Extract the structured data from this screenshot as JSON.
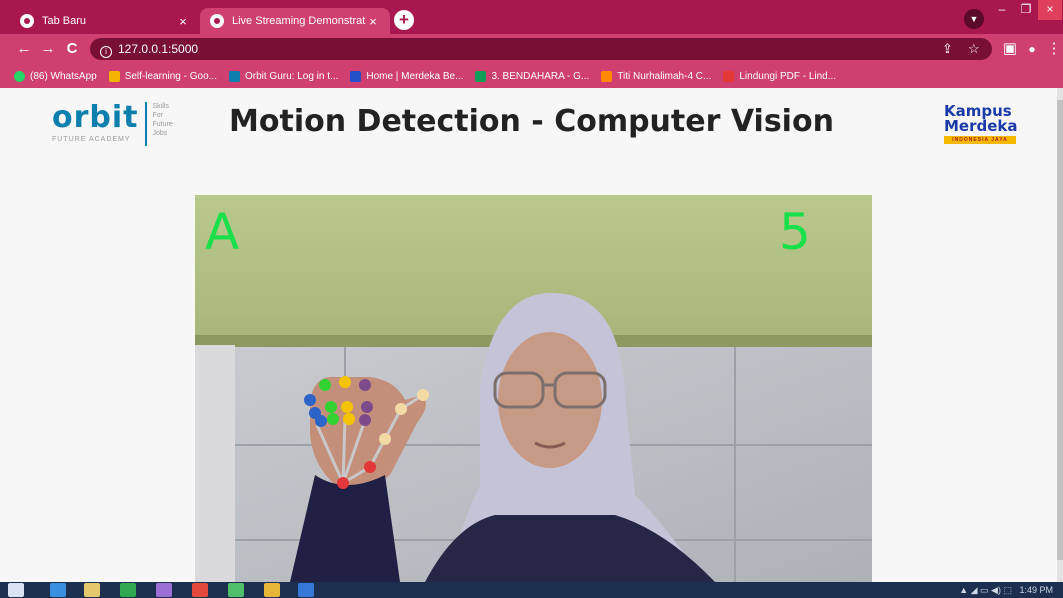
{
  "browser": {
    "tabs": [
      {
        "title": "Tab Baru",
        "active": false
      },
      {
        "title": "Live Streaming Demonstration",
        "active": true
      }
    ],
    "tab_close_glyph": "×",
    "new_tab_glyph": "+",
    "window_buttons": [
      "–",
      "❐",
      "×"
    ],
    "url": "127.0.0.1:5000",
    "bookmarks": [
      {
        "label": "(86) WhatsApp",
        "icon": "whatsapp-icon",
        "color": "#25d366"
      },
      {
        "label": "Self-learning - Goo...",
        "icon": "drive-icon",
        "color": "#f4b400"
      },
      {
        "label": "Orbit Guru: Log in t...",
        "icon": "orbit-icon",
        "color": "#0c7fae"
      },
      {
        "label": "Home | Merdeka Be...",
        "icon": "merdeka-icon",
        "color": "#2350c9"
      },
      {
        "label": "3. BENDAHARA - G...",
        "icon": "drive-icon",
        "color": "#0f9d58"
      },
      {
        "label": "Titi Nurhalimah-4 C...",
        "icon": "infinity-icon",
        "color": "#ff8a00"
      },
      {
        "label": "Lindungi PDF - Lind...",
        "icon": "pdf-icon",
        "color": "#e53935"
      }
    ]
  },
  "header": {
    "title": "Motion Detection - Computer Vision",
    "orbit_logo": {
      "word": "orbit",
      "subtitle": "FUTURE ACADEMY",
      "tagline": [
        "Skills",
        "For",
        "Future",
        "Jobs"
      ]
    },
    "kampus_logo": {
      "line1": "Kampus",
      "line2": "Merdeka",
      "band": "INDONESIA JAYA"
    }
  },
  "stream": {
    "letter": "A",
    "count": "5",
    "overlay_color": "#18e04a"
  },
  "taskbar": {
    "clock": "1:49 PM"
  },
  "colors": {
    "tabstrip": "#a8174e",
    "toolbar": "#cf3f6f",
    "orbit_blue": "#0c7fae",
    "kampus_blue": "#1a3aa8"
  }
}
